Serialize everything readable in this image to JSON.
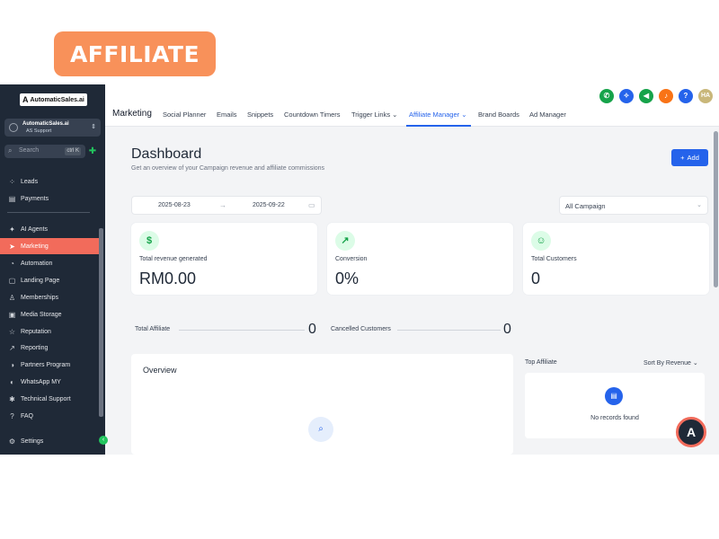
{
  "banner": {
    "text": "AFFILIATE"
  },
  "sidebar": {
    "logo_mark": "A",
    "logo_text": "AutomaticSales.ai",
    "account_name": "AutomaticSales.ai",
    "account_sub": "AS Support",
    "search_placeholder": "Search",
    "search_shortcut": "ctrl K",
    "items": [
      {
        "label": "Leads",
        "icon": "leads-icon",
        "glyph": "⁘"
      },
      {
        "label": "Payments",
        "icon": "payments-icon",
        "glyph": "▤"
      },
      {
        "label": "AI Agents",
        "icon": "ai-agents-icon",
        "glyph": "✦"
      },
      {
        "label": "Marketing",
        "icon": "marketing-icon",
        "glyph": "➤",
        "active": true
      },
      {
        "label": "Automation",
        "icon": "automation-icon",
        "glyph": "◔"
      },
      {
        "label": "Landing Page",
        "icon": "landing-page-icon",
        "glyph": "▢"
      },
      {
        "label": "Memberships",
        "icon": "memberships-icon",
        "glyph": "♙"
      },
      {
        "label": "Media Storage",
        "icon": "media-storage-icon",
        "glyph": "▣"
      },
      {
        "label": "Reputation",
        "icon": "reputation-icon",
        "glyph": "☆"
      },
      {
        "label": "Reporting",
        "icon": "reporting-icon",
        "glyph": "↗"
      },
      {
        "label": "Partners Program",
        "icon": "partners-program-icon",
        "glyph": "◑"
      },
      {
        "label": "WhatsApp MY",
        "icon": "whatsapp-icon",
        "glyph": "◐"
      },
      {
        "label": "Technical Support",
        "icon": "technical-support-icon",
        "glyph": "✱"
      },
      {
        "label": "FAQ",
        "icon": "faq-icon",
        "glyph": "?"
      },
      {
        "label": "Settings",
        "icon": "settings-icon",
        "glyph": "⚙"
      }
    ]
  },
  "header": {
    "section": "Marketing",
    "tabs": [
      "Social Planner",
      "Emails",
      "Snippets",
      "Countdown Timers",
      "Trigger Links",
      "Affiliate Manager",
      "Brand Boards",
      "Ad Manager"
    ],
    "active_tab": "Affiliate Manager",
    "user_initials": "HA",
    "icon_colors": {
      "phone": "#16a34a",
      "sparkle": "#2563eb",
      "megaphone": "#16a34a",
      "bell": "#f97316",
      "help": "#2563eb",
      "avatar": "#c9b77a"
    }
  },
  "dashboard": {
    "title": "Dashboard",
    "subtitle": "Get an overview of your Campaign revenue and affiliate commissions",
    "add_label": "Add",
    "date_from": "2025-08-23",
    "date_to": "2025-09-22",
    "campaign_select": "All Campaign",
    "cards": [
      {
        "label": "Total revenue generated",
        "value": "RM0.00",
        "icon": "dollar-icon",
        "glyph": "$"
      },
      {
        "label": "Conversion",
        "value": "0%",
        "icon": "trend-up-icon",
        "glyph": "↗"
      },
      {
        "label": "Total Customers",
        "value": "0",
        "icon": "customers-icon",
        "glyph": "☺"
      }
    ],
    "total_affiliate_label": "Total Affiliate",
    "total_affiliate_value": "0",
    "cancelled_label": "Cancelled Customers",
    "cancelled_value": "0",
    "overview_title": "Overview",
    "top_affiliate_title": "Top Affiliate",
    "sort_label": "Sort By Revenue",
    "no_records": "No records found"
  },
  "colors": {
    "accent": "#2563eb",
    "sidebar_bg": "#1f2937",
    "active_nav": "#f26b5b",
    "banner": "#f8915a"
  }
}
